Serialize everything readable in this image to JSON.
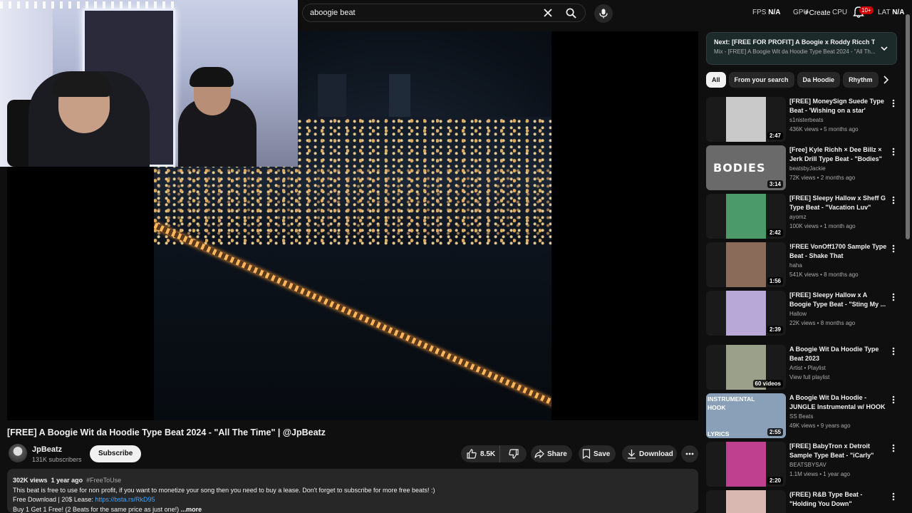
{
  "search": {
    "query": "aboogie beat"
  },
  "stats": {
    "fps_label": "FPS",
    "fps_value": "N/A",
    "gpu_label": "GPU",
    "create_label": "Create",
    "cpu_label": "CPU",
    "notifications": "10+",
    "lat_label": "LAT",
    "lat_value": "N/A"
  },
  "video": {
    "title": "[FREE] A Boogie Wit da Hoodie Type Beat 2024 - \"All The Time\" | @JpBeatz",
    "channel": "JpBeatz",
    "subscribers": "131K subscribers",
    "subscribe_label": "Subscribe",
    "likes": "8.5K",
    "share_label": "Share",
    "save_label": "Save",
    "download_label": "Download"
  },
  "description": {
    "views": "302K views",
    "age": "1 year ago",
    "hashtag": "#FreeToUse",
    "line1": "This beat is free to use for non profit, if you want to monetize your song then you need to buy a lease. Don't forget to subscribe for more free beats! :)",
    "line2_prefix": "Free Download | 20$ Lease: ",
    "line2_link": "https://bsta.rs/RkD95",
    "line3": "Buy 1 Get 1 Free! (2 Beats for the same price as just one!)",
    "more": "...more"
  },
  "next": {
    "title": "Next: [FREE FOR PROFIT] A Boogie x Roddy Ricch T...",
    "subtitle": "Mix - [FREE] A Boogie Wit da Hoodie Type Beat 2024 - \"All Th..."
  },
  "chips": [
    "All",
    "From your search",
    "Da Hoodie",
    "Rhythm"
  ],
  "recommendations": [
    {
      "title": "[FREE] MoneySign Suede Type Beat - 'Wishing on a star'",
      "channel": "s1nisterbeats",
      "stats": "436K views • 5 months ago",
      "duration": "2:47",
      "color": "#c9c9c9"
    },
    {
      "title": "[Free] Kyle Richh × Dee Billz × Jerk Drill Type Beat - \"Bodies\"",
      "channel": "beatsbyJackie",
      "stats": "72K views • 2 months ago",
      "duration": "3:14",
      "color": "#6a6a6a",
      "overlay": "BODIES"
    },
    {
      "title": "[FREE] Sleepy Hallow x Sheff G Type Beat - \"Vacation Luv\"",
      "channel": "ayomz",
      "stats": "100K views • 1 month ago",
      "duration": "2:42",
      "color": "#4a9a6a"
    },
    {
      "title": "!FREE VonOff1700 Sample Type Beat - Shake That",
      "channel": "haha",
      "stats": "541K views • 8 months ago",
      "duration": "1:56",
      "color": "#8a6a58"
    },
    {
      "title": "[FREE] Sleepy Hallow x A Boogie Type Beat - \"Sting My ...",
      "channel": "Hallow",
      "stats": "22K views • 8 months ago",
      "duration": "2:39",
      "color": "#b8a8d8"
    },
    {
      "title": "A Boogie Wit Da Hoodie Type Beat 2023",
      "channel": "Artist • Playlist",
      "stats": "View full playlist",
      "duration": "60 videos",
      "color": "#9aa08a",
      "playlist": true
    },
    {
      "title": "A Boogie Wit Da Hoodie - JUNGLE Instrumental w/ HOOK",
      "channel": "SS Beats",
      "stats": "49K views • 9 years ago",
      "duration": "2:55",
      "color": "#8aa0b8",
      "overlay_top": "INSTRUMENTAL HOOK",
      "overlay_bottom": "LYRICS"
    },
    {
      "title": "[FREE] BabyTron x Detroit Sample Type Beat - \"iCarly\"",
      "channel": "BEATSBYSAV",
      "stats": "1.1M views • 1 year ago",
      "duration": "2:20",
      "color": "#c04090"
    },
    {
      "title": "(FREE) R&B Type Beat - \"Holding You Down\"",
      "channel": "",
      "stats": "",
      "duration": "",
      "color": "#d8b8b0"
    }
  ]
}
